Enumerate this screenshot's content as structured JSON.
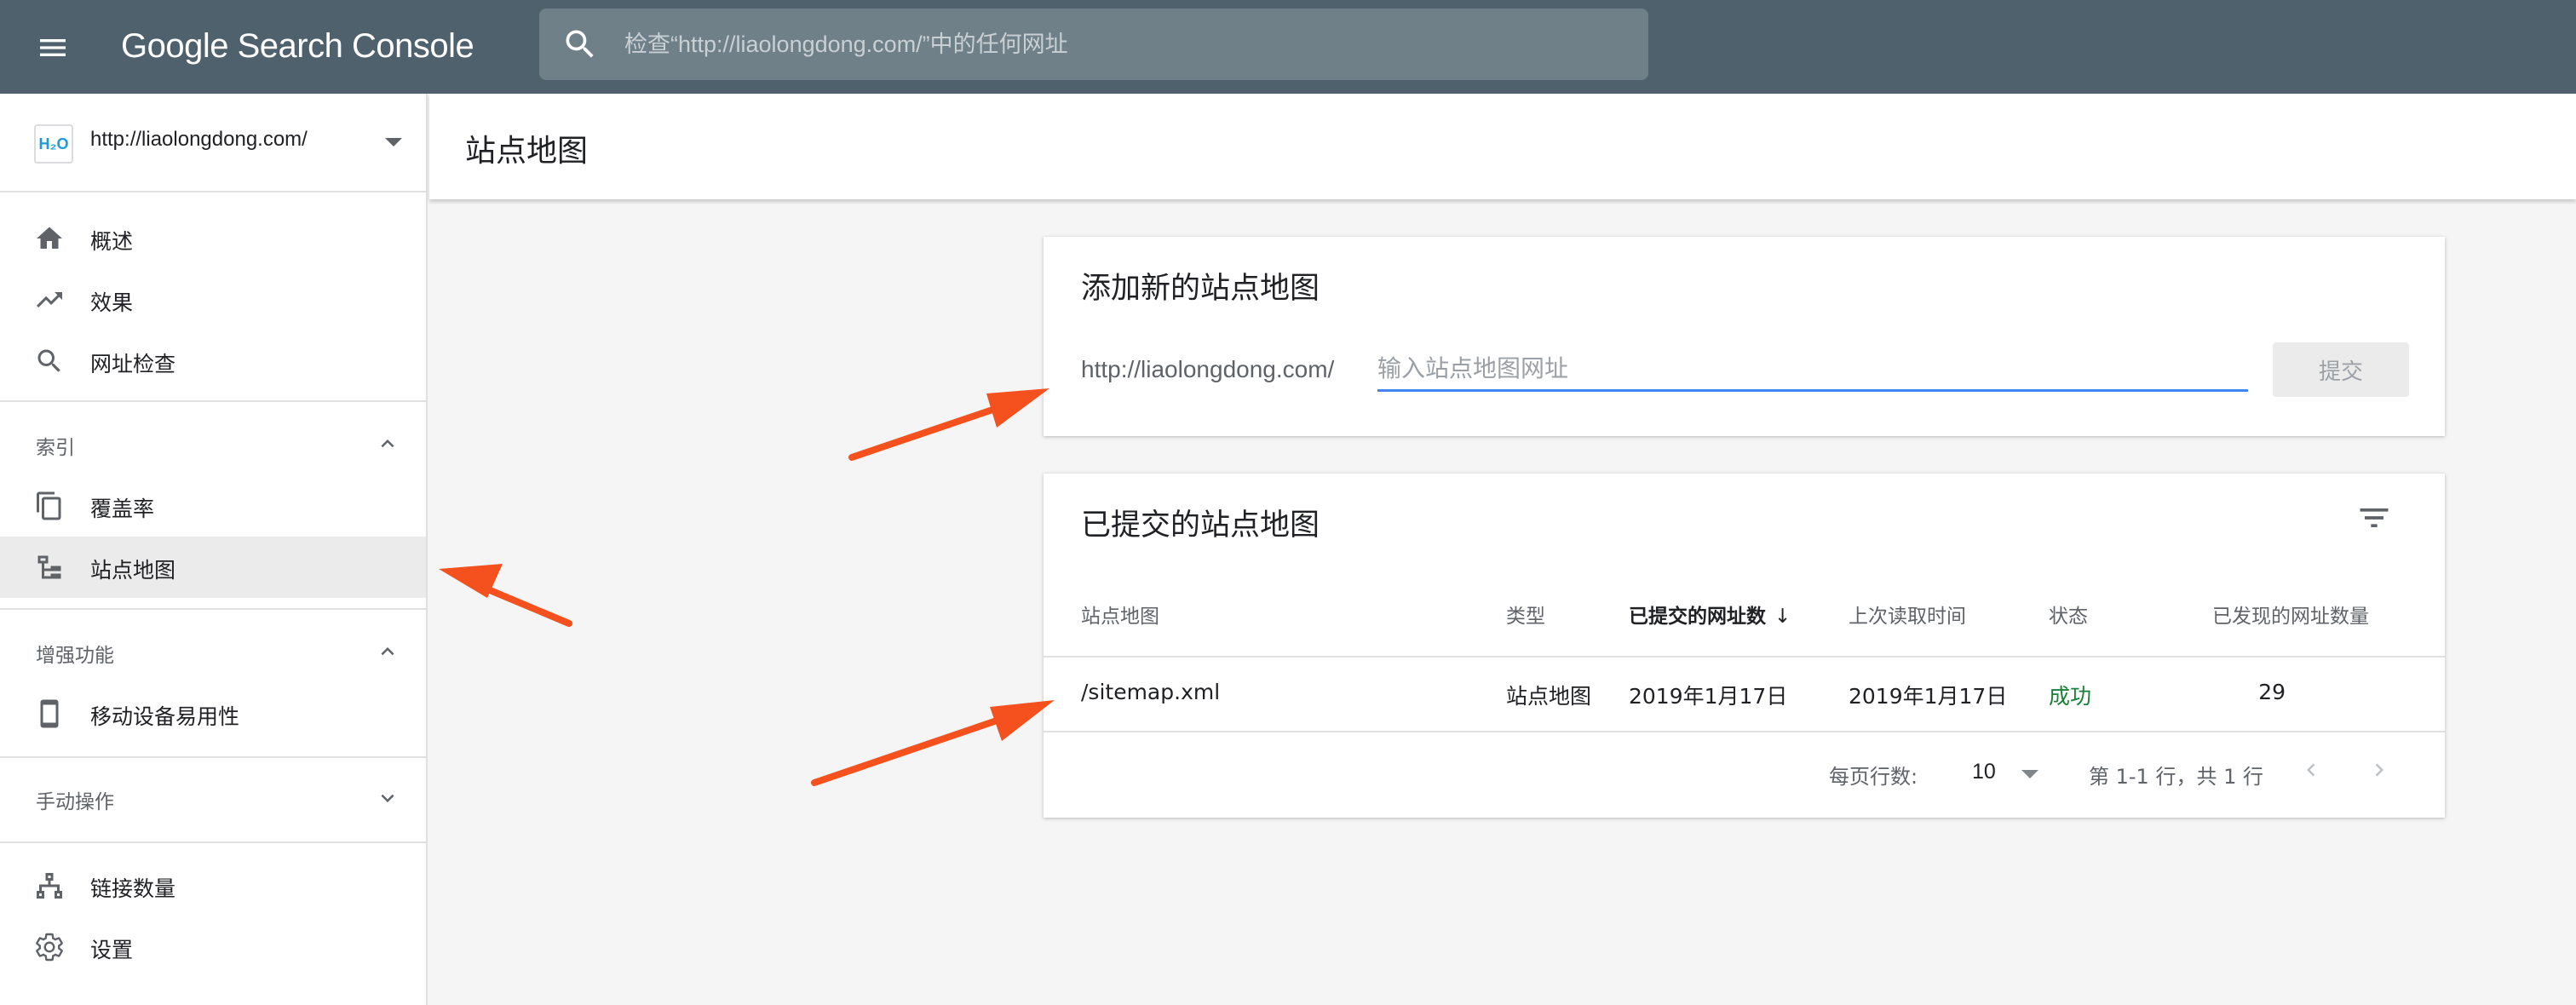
{
  "app": {
    "title": "Google Search Console",
    "search_placeholder": "检查“http://liaolongdong.com/”中的任何网址"
  },
  "sidebar": {
    "property_url": "http://liaolongdong.com/",
    "property_favicon": "H₂O",
    "nav_top": [
      {
        "label": "概述",
        "icon": "home-icon"
      },
      {
        "label": "效果",
        "icon": "trending-up-icon"
      },
      {
        "label": "网址检查",
        "icon": "search-icon"
      }
    ],
    "section_index": {
      "label": "索引",
      "expanded": true
    },
    "nav_index": [
      {
        "label": "覆盖率",
        "icon": "copy-pages-icon"
      },
      {
        "label": "站点地图",
        "icon": "sitemap-icon",
        "active": true
      }
    ],
    "section_enhance": {
      "label": "增强功能",
      "expanded": true
    },
    "nav_enhance": [
      {
        "label": "移动设备易用性",
        "icon": "smartphone-icon"
      }
    ],
    "section_manual": {
      "label": "手动操作",
      "expanded": false
    },
    "nav_bottom": [
      {
        "label": "链接数量",
        "icon": "links-network-icon"
      },
      {
        "label": "设置",
        "icon": "gear-icon"
      }
    ]
  },
  "main": {
    "page_title": "站点地图",
    "add_card": {
      "title": "添加新的站点地图",
      "url_prefix": "http://liaolongdong.com/",
      "input_placeholder": "输入站点地图网址",
      "submit_label": "提交"
    },
    "list_card": {
      "title": "已提交的站点地图",
      "columns": [
        "站点地图",
        "类型",
        "已提交的网址数",
        "上次读取时间",
        "状态",
        "已发现的网址数量"
      ],
      "sort_arrow": "↓",
      "rows": [
        {
          "sitemap": "/sitemap.xml",
          "type": "站点地图",
          "submitted": "2019年1月17日",
          "last_read": "2019年1月17日",
          "status": "成功",
          "discovered": "29"
        }
      ],
      "pager": {
        "rows_per_page_label": "每页行数:",
        "rows_per_page": "10",
        "range_text": "第 1-1 行，共 1 行"
      }
    }
  },
  "colors": {
    "topbar": "#4e616c",
    "accent_blue": "#4285f4",
    "success_green": "#188038",
    "annotation_arrow": "#f4511e"
  }
}
